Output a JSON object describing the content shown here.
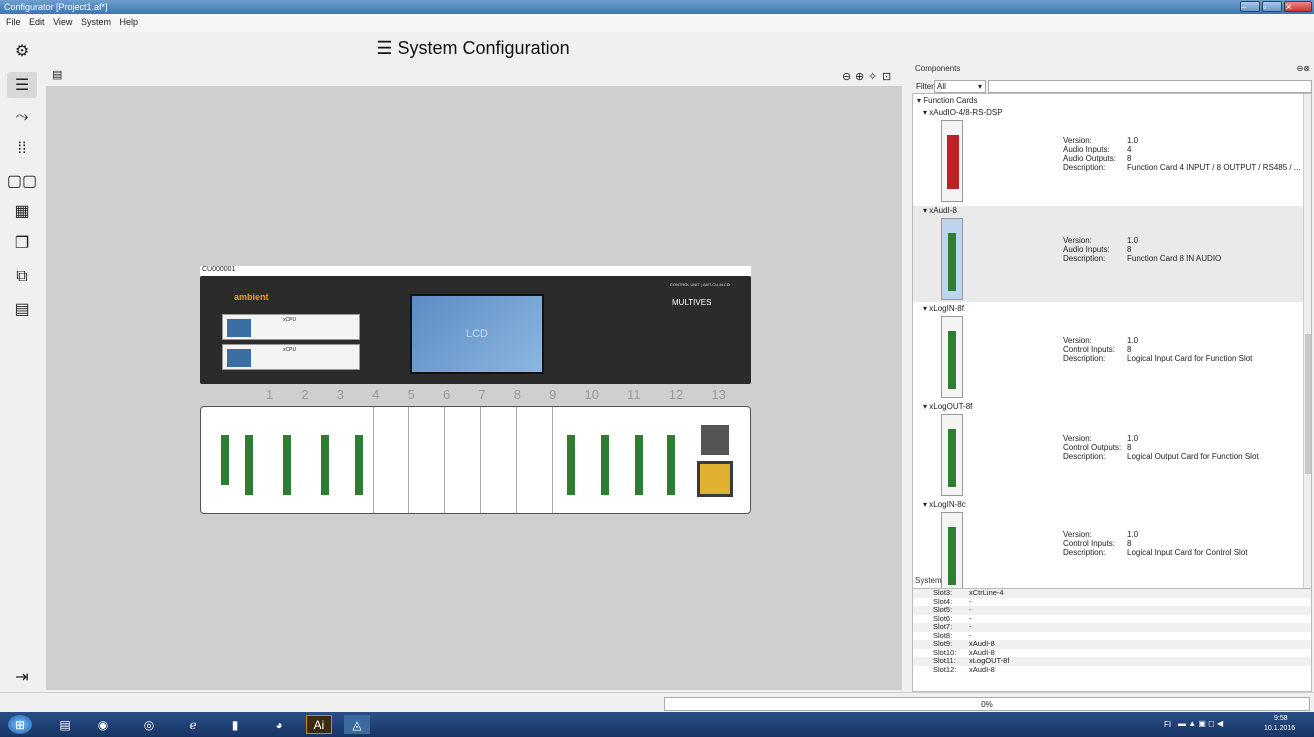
{
  "window": {
    "title": "Configurator [Project1.af*]"
  },
  "menu": [
    "File",
    "Edit",
    "View",
    "System",
    "Help"
  ],
  "page_title": "System Configuration",
  "toolbar": [
    "gear-icon",
    "rack-icon",
    "route-icon",
    "matrix-icon",
    "io-icon",
    "grid-icon",
    "window-icon",
    "device-icon",
    "document-icon",
    "exit-icon"
  ],
  "canvas": {
    "unit_label": "CU000001",
    "brand": "ambient",
    "vendor": "MULTIVES",
    "header_text": "CONTROL UNIT | AMT-CU-8LCD",
    "lcd": "LCD",
    "cpu_label": "xCPU",
    "slots": [
      "1",
      "2",
      "3",
      "4",
      "5",
      "6",
      "7",
      "8",
      "9",
      "10",
      "11",
      "12",
      "13"
    ]
  },
  "components": {
    "title": "Components",
    "filter_label": "Filter:",
    "filter_value": "All",
    "search_placeholder": "",
    "group": "Function Cards",
    "cards": [
      {
        "name": "xAudIO-4/8-RS-DSP",
        "props": [
          [
            "Version:",
            "1.0"
          ],
          [
            "Audio Inputs:",
            "4"
          ],
          [
            "Audio Outputs:",
            "8"
          ],
          [
            "Description:",
            "Function Card 4 INPUT / 8 OUTPUT / RS485 / ..."
          ]
        ]
      },
      {
        "name": "xAudI-8",
        "props": [
          [
            "Version:",
            "1.0"
          ],
          [
            "Audio Inputs:",
            "8"
          ],
          [
            "Description:",
            "Function Card 8 IN AUDIO"
          ]
        ]
      },
      {
        "name": "xLogIN-8f",
        "props": [
          [
            "Version:",
            "1.0"
          ],
          [
            "Control Inputs:",
            "8"
          ],
          [
            "Description:",
            "Logical Input Card for Function Slot"
          ]
        ]
      },
      {
        "name": "xLogOUT-8f",
        "props": [
          [
            "Version:",
            "1.0"
          ],
          [
            "Control Outputs:",
            "8"
          ],
          [
            "Description:",
            "Logical Output Card for Function Slot"
          ]
        ]
      },
      {
        "name": "xLogIN-8c",
        "props": [
          [
            "Version:",
            "1.0"
          ],
          [
            "Control Inputs:",
            "8"
          ],
          [
            "Description:",
            "Logical Input Card for Control Slot"
          ]
        ]
      }
    ]
  },
  "system": {
    "title": "System",
    "rows": [
      [
        "Slot3:",
        "xCtrLine-4"
      ],
      [
        "Slot4:",
        "-"
      ],
      [
        "Slot5:",
        "-"
      ],
      [
        "Slot6:",
        "-"
      ],
      [
        "Slot7:",
        "-"
      ],
      [
        "Slot8:",
        "-"
      ],
      [
        "Slot9:",
        "xAudI-8"
      ],
      [
        "Slot10:",
        "xAudI-8"
      ],
      [
        "Slot11:",
        "xLogOUT-8f"
      ],
      [
        "Slot12:",
        "xAudI-8"
      ]
    ]
  },
  "progress": "0%",
  "taskbar": {
    "time": "9:58",
    "date": "10.1.2016",
    "lang": "FI"
  }
}
